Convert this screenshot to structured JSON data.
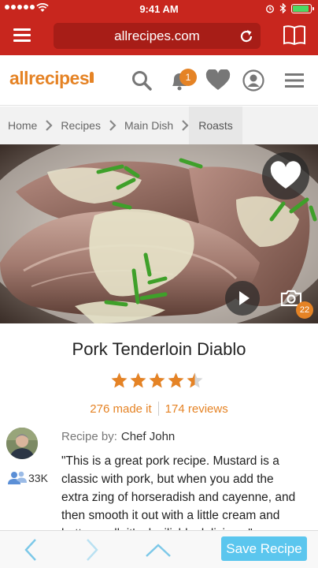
{
  "status_bar": {
    "time": "9:41 AM",
    "battery_level": 0.95
  },
  "browser": {
    "url": "allrecipes.com"
  },
  "site": {
    "logo_text": "allrecipes",
    "notification_count": "1"
  },
  "breadcrumb": [
    "Home",
    "Recipes",
    "Main Dish",
    "Roasts"
  ],
  "hero": {
    "photo_count": "22"
  },
  "recipe": {
    "title": "Pork Tenderloin Diablo",
    "rating": 4.5,
    "made_it": "276 made it",
    "reviews": "174 reviews",
    "by_label": "Recipe by:",
    "author": "Chef John",
    "followers": "33K",
    "description": "\"This is a great pork recipe. Mustard is a classic with pork, but when you add the extra zing of horseradish and cayenne, and then smooth it out with a little cream and butter, well, it's devilishly delicious.\""
  },
  "toolbar": {
    "save_label": "Save Recipe"
  },
  "colors": {
    "brand_red": "#c8261e",
    "accent_orange": "#e58325",
    "save_blue": "#5bc6ee"
  },
  "icons": [
    "hamburger-icon",
    "reload-icon",
    "bookmarks-icon",
    "search-icon",
    "bell-icon",
    "heart-icon",
    "user-icon",
    "menu-icon",
    "chevron-right-icon",
    "play-icon",
    "camera-icon",
    "star-icon",
    "followers-icon",
    "back-icon",
    "forward-icon",
    "share-icon"
  ]
}
